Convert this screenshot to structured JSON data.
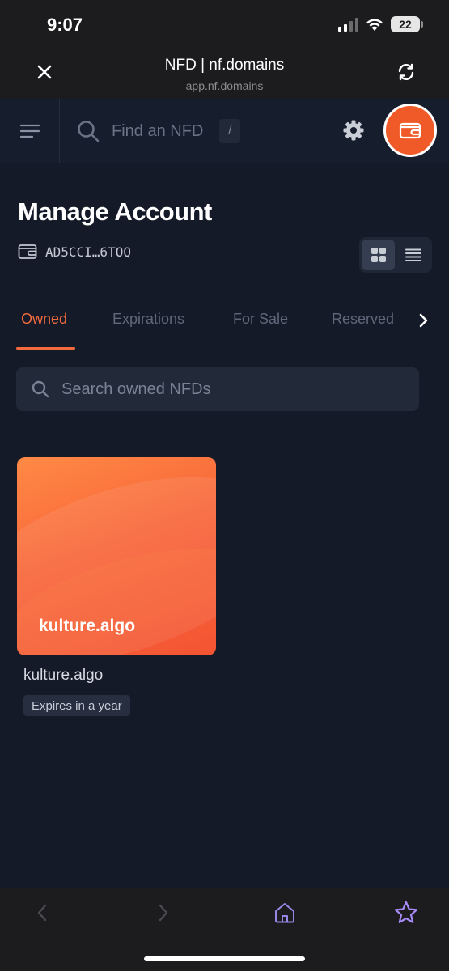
{
  "status_bar": {
    "time": "9:07",
    "battery": "22"
  },
  "browser": {
    "title": "NFD | nf.domains",
    "url": "app.nf.domains"
  },
  "nav": {
    "search_placeholder": "Find an NFD",
    "shortcut": "/"
  },
  "page": {
    "heading": "Manage Account",
    "account_address": "AD5CCI…6TOQ"
  },
  "tabs": [
    {
      "label": "Owned",
      "active": true
    },
    {
      "label": "Expirations",
      "active": false
    },
    {
      "label": "For Sale",
      "active": false
    },
    {
      "label": "Reserved",
      "active": false
    }
  ],
  "owned_search": {
    "placeholder": "Search owned NFDs"
  },
  "nfds": [
    {
      "card_label": "kulture.algo",
      "name": "kulture.algo",
      "status": "Expires in a year"
    }
  ],
  "colors": {
    "accent": "#f26a3d",
    "wallet": "#f05a28",
    "background": "#141a28",
    "bookmark_star": "#a78bfa"
  },
  "icons": [
    "close-icon",
    "refresh-icon",
    "menu-icon",
    "search-icon",
    "gear-icon",
    "wallet-icon",
    "grid-view-icon",
    "list-view-icon",
    "chevron-right-icon",
    "back-icon",
    "forward-icon",
    "home-icon",
    "star-icon"
  ]
}
